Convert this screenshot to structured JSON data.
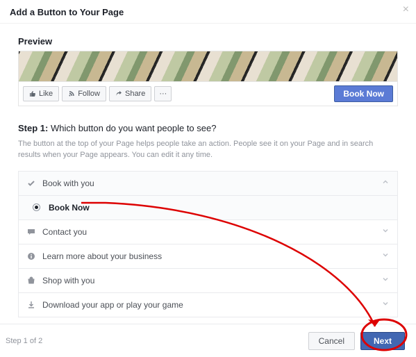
{
  "modal": {
    "title": "Add a Button to Your Page",
    "close": "×"
  },
  "preview": {
    "heading": "Preview",
    "like": "Like",
    "follow": "Follow",
    "share": "Share",
    "more": "···",
    "cta": "Book Now"
  },
  "step": {
    "label_num": "Step 1:",
    "label_q": "Which button do you want people to see?",
    "help": "The button at the top of your Page helps people take an action. People see it on your Page and in search results when your Page appears. You can edit it any time."
  },
  "accordion": {
    "items": [
      {
        "icon": "check",
        "label": "Book with you",
        "selected_child": "Book Now"
      },
      {
        "icon": "chat",
        "label": "Contact you"
      },
      {
        "icon": "info",
        "label": "Learn more about your business"
      },
      {
        "icon": "bag",
        "label": "Shop with you"
      },
      {
        "icon": "download",
        "label": "Download your app or play your game"
      }
    ]
  },
  "footer": {
    "step_of": "Step 1 of 2",
    "cancel": "Cancel",
    "next": "Next"
  },
  "annotation": {
    "color": "#d00"
  }
}
